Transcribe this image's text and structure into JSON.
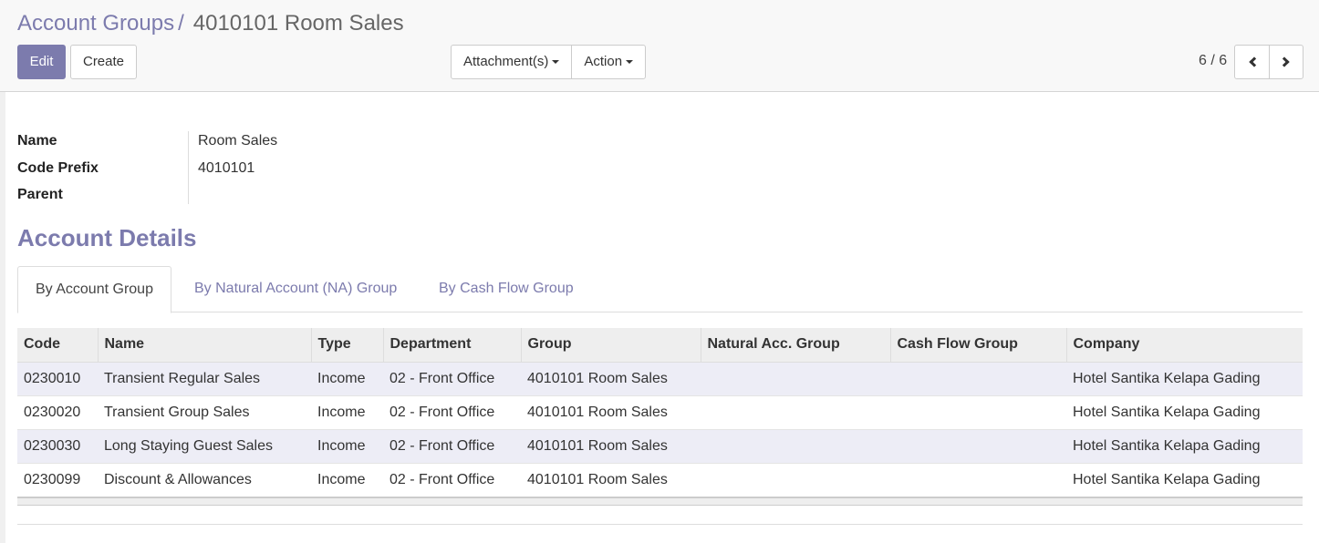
{
  "breadcrumb": {
    "parent": "Account Groups",
    "separator": "/",
    "current": "4010101 Room Sales"
  },
  "toolbar": {
    "edit_label": "Edit",
    "create_label": "Create",
    "attachments_label": "Attachment(s)",
    "action_label": "Action"
  },
  "pager": {
    "value": "6 / 6",
    "prev_icon": "chevron-left-icon",
    "next_icon": "chevron-right-icon"
  },
  "form": {
    "fields": [
      {
        "label": "Name",
        "value": "Room Sales"
      },
      {
        "label": "Code Prefix",
        "value": "4010101"
      },
      {
        "label": "Parent",
        "value": ""
      }
    ]
  },
  "section": {
    "title": "Account Details"
  },
  "tabs": [
    {
      "label": "By Account Group",
      "active": true
    },
    {
      "label": "By Natural Account (NA) Group",
      "active": false
    },
    {
      "label": "By Cash Flow Group",
      "active": false
    }
  ],
  "table": {
    "columns": [
      "Code",
      "Name",
      "Type",
      "Department",
      "Group",
      "Natural Acc. Group",
      "Cash Flow Group",
      "Company"
    ],
    "rows": [
      [
        "0230010",
        "Transient Regular Sales",
        "Income",
        "02 - Front Office",
        "4010101 Room Sales",
        "",
        "",
        "Hotel Santika Kelapa Gading"
      ],
      [
        "0230020",
        "Transient Group Sales",
        "Income",
        "02 - Front Office",
        "4010101 Room Sales",
        "",
        "",
        "Hotel Santika Kelapa Gading"
      ],
      [
        "0230030",
        "Long Staying Guest Sales",
        "Income",
        "02 - Front Office",
        "4010101 Room Sales",
        "",
        "",
        "Hotel Santika Kelapa Gading"
      ],
      [
        "0230099",
        "Discount & Allowances",
        "Income",
        "02 - Front Office",
        "4010101 Room Sales",
        "",
        "",
        "Hotel Santika Kelapa Gading"
      ]
    ]
  },
  "colors": {
    "brand": "#7c7bad",
    "row_stripe": "#ededf6",
    "header_bg": "#eeeeee"
  }
}
